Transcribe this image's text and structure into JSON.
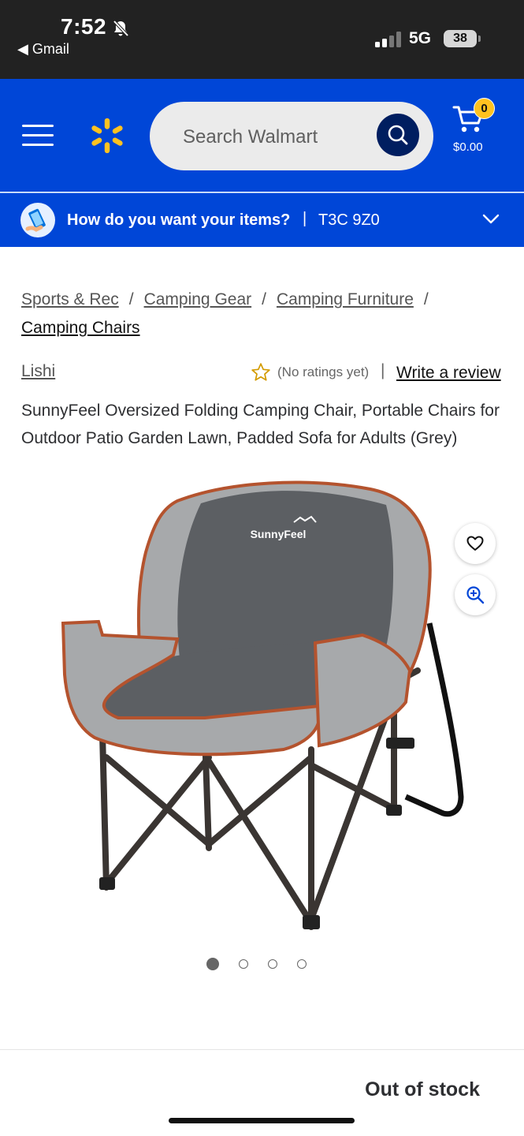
{
  "status": {
    "time": "7:52",
    "back_app": "◀ Gmail",
    "network": "5G",
    "battery": "38"
  },
  "header": {
    "search_placeholder": "Search Walmart",
    "cart_count": "0",
    "cart_total": "$0.00",
    "brand_color": "#0046d7",
    "accent_color": "#ffc220"
  },
  "delivery": {
    "question": "How do you want your items?",
    "separator": "|",
    "postal_code": "T3C 9Z0"
  },
  "breadcrumb": {
    "items": [
      "Sports & Rec",
      "Camping Gear",
      "Camping Furniture",
      "Camping Chairs"
    ],
    "separator": "/"
  },
  "product": {
    "brand": "Lishi",
    "rating_text": "(No ratings yet)",
    "rating_separator": "|",
    "write_review": "Write a review",
    "title": "SunnyFeel Oversized Folding Camping Chair, Portable Chairs for Outdoor Patio Garden Lawn, Padded Sofa for Adults (Grey)",
    "image_logo_text": "SunnyFeel",
    "image_count": 4,
    "active_image": 1,
    "availability": "Out of stock"
  },
  "icons": {
    "menu": "hamburger-icon",
    "logo": "walmart-spark-icon",
    "search": "search-icon",
    "cart": "cart-icon",
    "favorite": "heart-icon",
    "zoom": "zoom-in-icon",
    "chevron": "chevron-down-icon"
  }
}
